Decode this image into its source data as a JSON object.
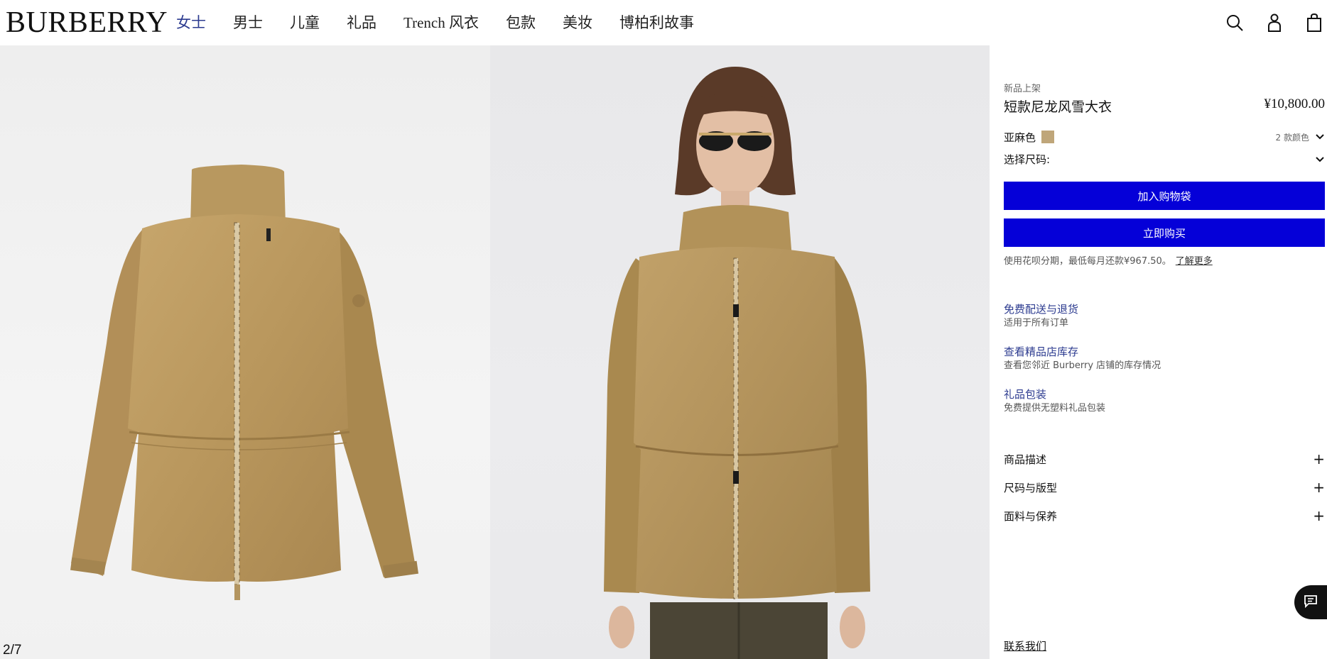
{
  "brand": {
    "logo": "BURBERRY"
  },
  "nav": {
    "items": [
      {
        "label": "女士",
        "active": true
      },
      {
        "label": "男士"
      },
      {
        "label": "儿童"
      },
      {
        "label": "礼品"
      },
      {
        "label": "Trench 风衣"
      },
      {
        "label": "包款"
      },
      {
        "label": "美妆"
      },
      {
        "label": "博柏利故事"
      }
    ]
  },
  "header_icons": [
    "search-icon",
    "account-icon",
    "shopping-bag-icon"
  ],
  "gallery": {
    "counter": "2/7"
  },
  "product": {
    "badge": "新品上架",
    "title": "短款尼龙风雪大衣",
    "price": "¥10,800.00",
    "color_label": "亚麻色",
    "swatch_color": "#bfa67a",
    "color_count": "2 款颜色",
    "size_label": "选择尺码:",
    "add_to_bag": "加入购物袋",
    "buy_now": "立即购买",
    "installment_text": "使用花呗分期，最低每月还款¥967.50。",
    "installment_link": "了解更多"
  },
  "services": [
    {
      "title": "免费配送与退货",
      "subtitle": "适用于所有订单"
    },
    {
      "title": "查看精品店库存",
      "subtitle": "查看您邻近 Burberry 店铺的库存情况"
    },
    {
      "title": "礼品包装",
      "subtitle": "免费提供无塑料礼品包装"
    }
  ],
  "accordions": [
    {
      "label": "商品描述"
    },
    {
      "label": "尺码与版型"
    },
    {
      "label": "面料与保养"
    }
  ],
  "footer": {
    "contact": "联系我们"
  },
  "colors": {
    "accent_blue": "#0500d8",
    "link_blue": "#2b3a8f"
  }
}
